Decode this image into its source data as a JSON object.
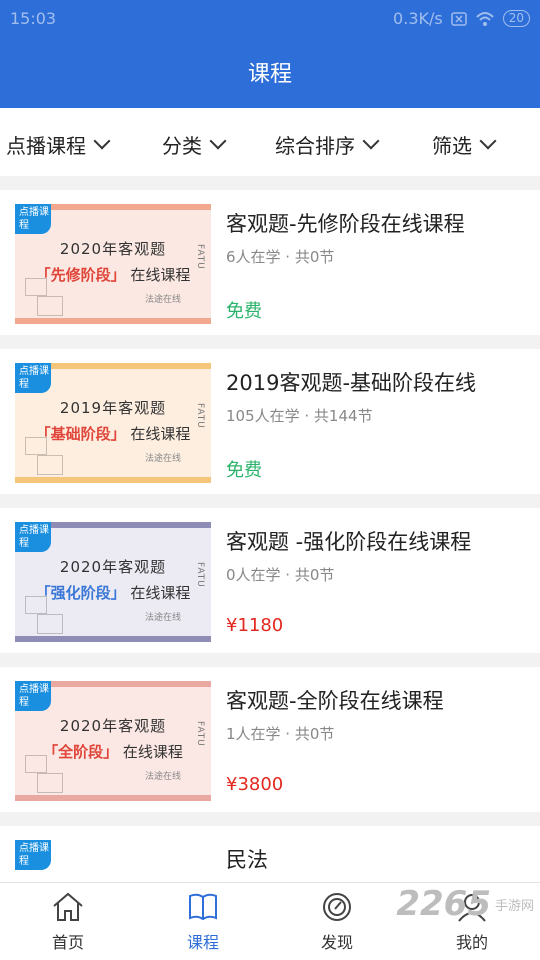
{
  "status_bar": {
    "time": "15:03",
    "speed": "0.3K/s",
    "battery": "20"
  },
  "header": {
    "title": "课程"
  },
  "filters": [
    {
      "label": "点播课程"
    },
    {
      "label": "分类"
    },
    {
      "label": "综合排序"
    },
    {
      "label": "筛选"
    }
  ],
  "courses": [
    {
      "title": "客观题-先修阶段在线课程",
      "meta": "6人在学 · 共0节",
      "price": "免费",
      "price_color": "#2bb36b",
      "thumb": {
        "badge": "点播课程",
        "line1": "2020年客观题",
        "highlight": "「先修阶段」",
        "line2_suffix": "在线课程",
        "brand": "FATU",
        "logo": "法途在线",
        "bg": "#fbe8e2",
        "accent": "#e0453a",
        "stripe": "#f2a78f"
      }
    },
    {
      "title": "2019客观题-基础阶段在线",
      "meta": "105人在学 · 共144节",
      "price": "免费",
      "price_color": "#2bb36b",
      "thumb": {
        "badge": "点播课程",
        "line1": "2019年客观题",
        "highlight": "「基础阶段」",
        "line2_suffix": "在线课程",
        "brand": "FATU",
        "logo": "法途在线",
        "bg": "#fdeee0",
        "accent": "#e0453a",
        "stripe": "#f5c57a"
      }
    },
    {
      "title": "客观题 -强化阶段在线课程",
      "meta": "0人在学 · 共0节",
      "price": "¥1180",
      "price_color": "#e3281f",
      "thumb": {
        "badge": "点播课程",
        "line1": "2020年客观题",
        "highlight": "「强化阶段」",
        "line2_suffix": "在线课程",
        "brand": "FATU",
        "logo": "法途在线",
        "bg": "#eceaf2",
        "accent": "#3a78d8",
        "stripe": "#8f8cb5"
      }
    },
    {
      "title": "客观题-全阶段在线课程",
      "meta": "1人在学 · 共0节",
      "price": "¥3800",
      "price_color": "#e3281f",
      "thumb": {
        "badge": "点播课程",
        "line1": "2020年客观题",
        "highlight": "「全阶段」",
        "line2_suffix": "在线课程",
        "brand": "FATU",
        "logo": "法途在线",
        "bg": "#fbe8e4",
        "accent": "#e0453a",
        "stripe": "#e9a9a0"
      }
    },
    {
      "title": "民法",
      "meta": "",
      "price": "",
      "price_color": "#e3281f",
      "thumb": {
        "badge": "点播课程",
        "line1": "",
        "highlight": "",
        "line2_suffix": "",
        "brand": "",
        "logo": "",
        "bg": "#ffffff",
        "accent": "#1c3f8a",
        "stripe": "#ffffff"
      }
    }
  ],
  "tabs": [
    {
      "label": "首页",
      "icon": "home-icon",
      "active": false
    },
    {
      "label": "课程",
      "icon": "book-icon",
      "active": true
    },
    {
      "label": "发现",
      "icon": "compass-icon",
      "active": false
    },
    {
      "label": "我的",
      "icon": "user-icon",
      "active": false
    }
  ],
  "watermark": {
    "num": "2265",
    "text": "手游网"
  }
}
